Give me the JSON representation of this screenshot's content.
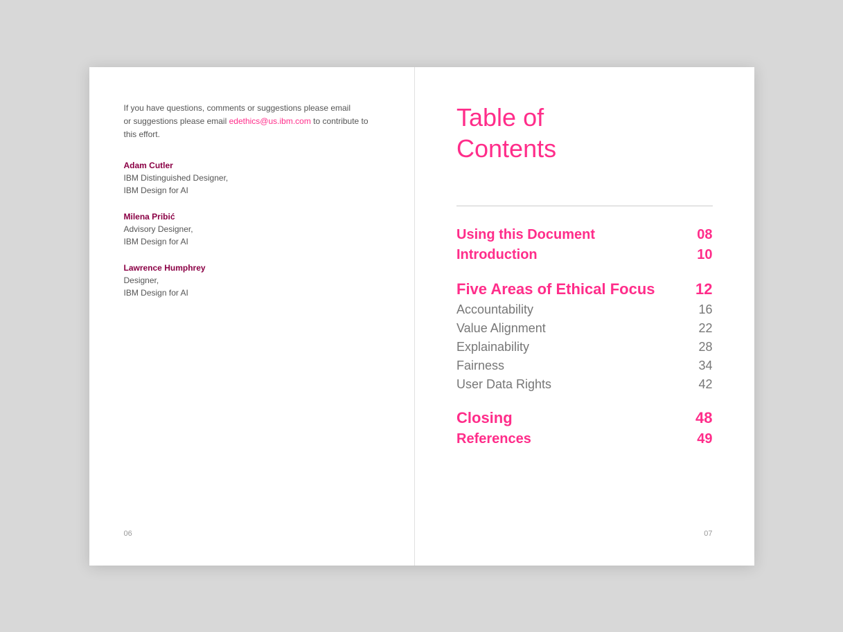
{
  "left_page": {
    "intro_text_1": "If you have questions, comments or suggestions please email",
    "email": "edethics@us.ibm.com",
    "intro_text_2": "to contribute to this effort.",
    "contributors": [
      {
        "name": "Adam Cutler",
        "role_line1": "IBM Distinguished Designer,",
        "role_line2": "IBM Design for AI"
      },
      {
        "name": "Milena Pribić",
        "role_line1": "Advisory Designer,",
        "role_line2": "IBM Design for AI"
      },
      {
        "name": "Lawrence Humphrey",
        "role_line1": "Designer,",
        "role_line2": "IBM Design for AI"
      }
    ],
    "page_number": "06"
  },
  "right_page": {
    "toc_title_line1": "Table of",
    "toc_title_line2": "Contents",
    "sections": [
      {
        "label": "Using this Document",
        "number": "08",
        "bold": true,
        "large": false,
        "subsections": []
      },
      {
        "label": "Introduction",
        "number": "10",
        "bold": true,
        "large": false,
        "subsections": []
      },
      {
        "label": "Five Areas of Ethical Focus",
        "number": "12",
        "bold": true,
        "large": true,
        "subsections": [
          {
            "label": "Accountability",
            "number": "16"
          },
          {
            "label": "Value Alignment",
            "number": "22"
          },
          {
            "label": "Explainability",
            "number": "28"
          },
          {
            "label": "Fairness",
            "number": "34"
          },
          {
            "label": "User Data Rights",
            "number": "42"
          }
        ]
      },
      {
        "label": "Closing",
        "number": "48",
        "bold": true,
        "large": false,
        "subsections": []
      },
      {
        "label": "References",
        "number": "49",
        "bold": true,
        "large": false,
        "subsections": []
      }
    ],
    "page_number": "07"
  }
}
